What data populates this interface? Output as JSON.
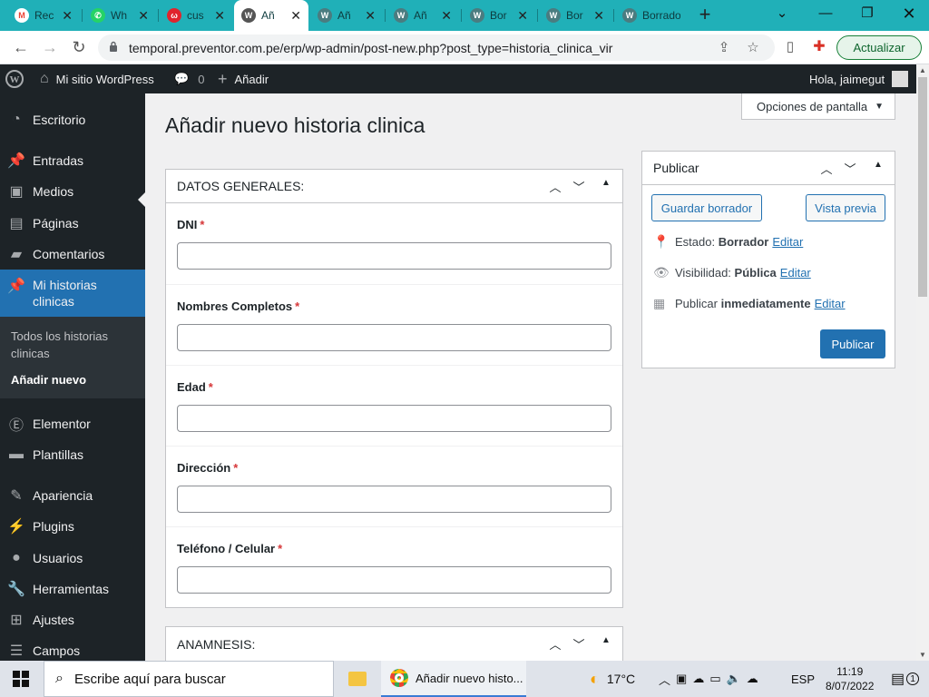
{
  "browser": {
    "tabs": [
      {
        "label": "Rec",
        "favicon": "gmail-icon",
        "color": "#ea4335",
        "active": false
      },
      {
        "label": "Wh",
        "favicon": "whatsapp-icon",
        "color": "#25d366",
        "active": false
      },
      {
        "label": "cus",
        "favicon": "app-icon",
        "color": "#e0242d",
        "active": false
      },
      {
        "label": "Añ",
        "favicon": "wordpress-icon",
        "color": "#555555",
        "active": true
      },
      {
        "label": "Añ",
        "favicon": "wordpress-icon",
        "color": "#555555",
        "active": false
      },
      {
        "label": "Añ",
        "favicon": "wordpress-icon",
        "color": "#555555",
        "active": false
      },
      {
        "label": "Bor",
        "favicon": "wordpress-icon",
        "color": "#555555",
        "active": false
      },
      {
        "label": "Bor",
        "favicon": "wordpress-icon",
        "color": "#555555",
        "active": false
      },
      {
        "label": "Borrado",
        "favicon": "wordpress-icon",
        "color": "#555555",
        "active": false
      }
    ],
    "url": "temporal.preventor.com.pe/erp/wp-admin/post-new.php?post_type=historia_clinica_vir",
    "update_label": "Actualizar"
  },
  "adminbar": {
    "site_name": "Mi sitio WordPress",
    "comments_count": "0",
    "add_label": "Añadir",
    "greeting": "Hola, jaimegut"
  },
  "menu": {
    "items": [
      {
        "label": "Escritorio",
        "icon": "dashboard-icon"
      },
      {
        "label": "Entradas",
        "icon": "pin-icon"
      },
      {
        "label": "Medios",
        "icon": "media-icon"
      },
      {
        "label": "Páginas",
        "icon": "pages-icon"
      },
      {
        "label": "Comentarios",
        "icon": "comments-icon"
      },
      {
        "label": "Mi historias clinicas",
        "icon": "pin-icon"
      },
      {
        "label": "Elementor",
        "icon": "elementor-icon"
      },
      {
        "label": "Plantillas",
        "icon": "folder-icon"
      },
      {
        "label": "Apariencia",
        "icon": "brush-icon"
      },
      {
        "label": "Plugins",
        "icon": "plugin-icon"
      },
      {
        "label": "Usuarios",
        "icon": "user-icon"
      },
      {
        "label": "Herramientas",
        "icon": "wrench-icon"
      },
      {
        "label": "Ajustes",
        "icon": "settings-icon"
      },
      {
        "label": "Campos",
        "icon": "fields-icon"
      }
    ],
    "submenu": [
      "Todos los historias clinicas",
      "Añadir nuevo"
    ]
  },
  "screen_options": "Opciones de pantalla",
  "page_title": "Añadir nuevo historia clinica",
  "datos_generales": {
    "title": "DATOS GENERALES:",
    "fields": [
      {
        "label": "DNI",
        "value": ""
      },
      {
        "label": "Nombres Completos",
        "value": ""
      },
      {
        "label": "Edad",
        "value": ""
      },
      {
        "label": "Dirección",
        "value": ""
      },
      {
        "label": "Teléfono / Celular",
        "value": ""
      }
    ],
    "required_mark": "*"
  },
  "anamnesis": {
    "title": "ANAMNESIS:"
  },
  "publish": {
    "title": "Publicar",
    "save_draft": "Guardar borrador",
    "preview": "Vista previa",
    "status_label": "Estado:",
    "status_value": "Borrador",
    "visibility_label": "Visibilidad:",
    "visibility_value": "Pública",
    "schedule_label": "Publicar",
    "schedule_value": "inmediatamente",
    "edit": "Editar",
    "publish_button": "Publicar"
  },
  "taskbar": {
    "search_placeholder": "Escribe aquí para buscar",
    "chrome_window": "Añadir nuevo histo...",
    "temperature": "17°C",
    "language": "ESP",
    "time": "11:19",
    "date": "8/07/2022",
    "notifications": "1"
  },
  "colors": {
    "wp_blue": "#2271b1",
    "admin_dark": "#1d2327",
    "chrome_teal": "#20b0b8"
  }
}
